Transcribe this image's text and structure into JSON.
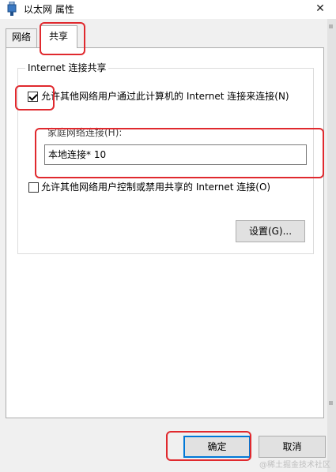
{
  "window": {
    "title": "以太网 属性",
    "close_glyph": "✕"
  },
  "tabs": [
    {
      "label": "网络"
    },
    {
      "label": "共享"
    }
  ],
  "group": {
    "title": "Internet 连接共享"
  },
  "allow_share": {
    "label": "允许其他网络用户通过此计算机的 Internet 连接来连接(N)",
    "checked": true
  },
  "home_network": {
    "label": "家庭网络连接(H):",
    "selected_value": "本地连接* 10"
  },
  "allow_control": {
    "label": "允许其他网络用户控制或禁用共享的 Internet 连接(O)",
    "checked": false
  },
  "buttons": {
    "settings": "设置(G)...",
    "ok": "确定",
    "cancel": "取消"
  },
  "watermark": "@稀土掘金技术社区",
  "colors": {
    "highlight": "#e0292e",
    "default_button_border": "#0078d7",
    "dialog_background": "#f0f0f0"
  },
  "icons": {
    "title": "network-adapter-icon",
    "close": "close-icon",
    "check": "checkmark-icon"
  }
}
